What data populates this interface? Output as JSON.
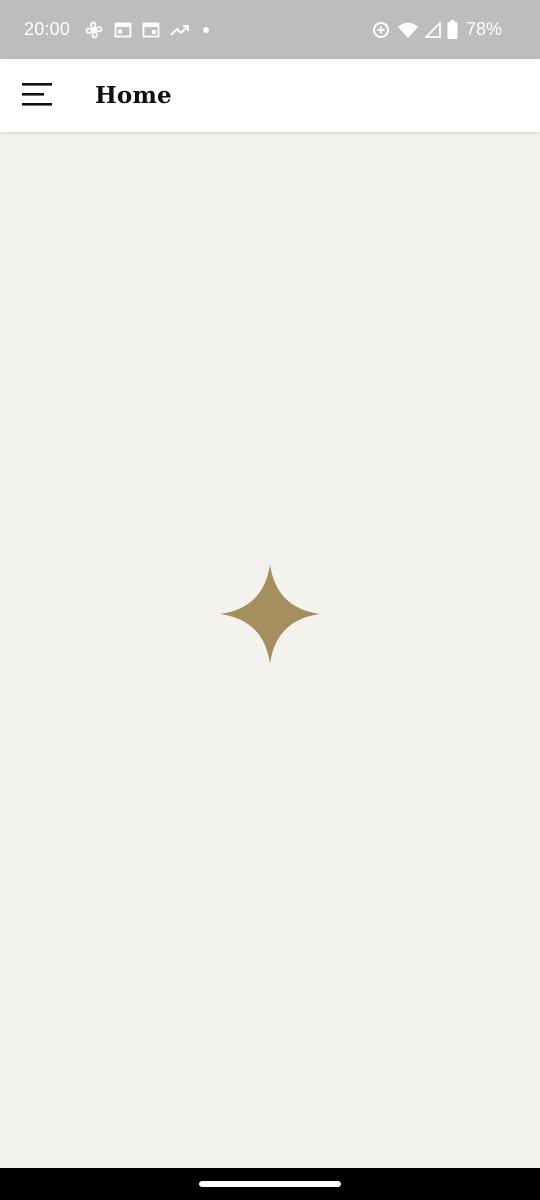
{
  "status_bar": {
    "time": "20:00",
    "battery_percent": "78%",
    "left_icons": [
      "fan-icon",
      "calendar-icon",
      "calendar-icon",
      "trending-up-icon",
      "dot-icon"
    ],
    "right_icons": [
      "data-saver-icon",
      "wifi-icon",
      "cell-signal-icon",
      "battery-icon"
    ],
    "background_color": "#bdbdbd"
  },
  "app_bar": {
    "title": "Home",
    "menu_icon": "hamburger-menu-icon"
  },
  "content": {
    "loading_icon": "four-point-star-icon",
    "background_color": "#f4f2ed",
    "accent_color": "#a58f5e"
  },
  "nav_bar": {
    "handle": "home-gesture-handle"
  }
}
